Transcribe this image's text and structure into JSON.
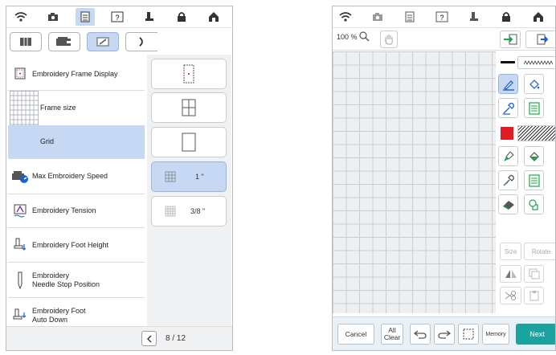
{
  "left": {
    "menu": [
      {
        "label": "Embroidery Frame Display",
        "icon": "frame-display-icon"
      },
      {
        "label": "Frame size",
        "icon": "frame-size-grid-icon"
      },
      {
        "label": "Grid",
        "icon": "",
        "selected": true
      },
      {
        "label": "Max Embroidery Speed",
        "icon": "sewing-speed-icon"
      },
      {
        "label": "Embroidery Tension",
        "icon": "tension-icon"
      },
      {
        "label": "Embroidery Foot Height",
        "icon": "foot-height-icon"
      },
      {
        "label_line1": "Embroidery",
        "label_line2": "Needle Stop Position",
        "icon": "needle-icon"
      },
      {
        "label_line1": "Embroidery Foot",
        "label_line2": "Auto Down",
        "icon": "foot-auto-down-icon"
      }
    ],
    "grid_options": [
      {
        "label": "",
        "icon": "center-dot-icon"
      },
      {
        "label": "",
        "icon": "cross-grid-icon"
      },
      {
        "label": "",
        "icon": "no-grid-icon"
      },
      {
        "label": "1 \"",
        "icon": "small-grid-icon",
        "selected": true
      },
      {
        "label": "3/8 \"",
        "icon": "fine-grid-icon"
      }
    ],
    "pager": {
      "text": "8 / 12"
    }
  },
  "right": {
    "zoom_label": "100 %",
    "bottom_buttons": {
      "cancel": "Cancel",
      "all_clear_1": "All",
      "all_clear_2": "Clear",
      "memory": "Memory",
      "next": "Next"
    },
    "tool_labels": {
      "size": "Size",
      "rotate": "Rotate"
    }
  },
  "colors": {
    "accent": "#c7d8f5",
    "next": "#1ba3a0",
    "swatch_red": "#e01b24"
  }
}
